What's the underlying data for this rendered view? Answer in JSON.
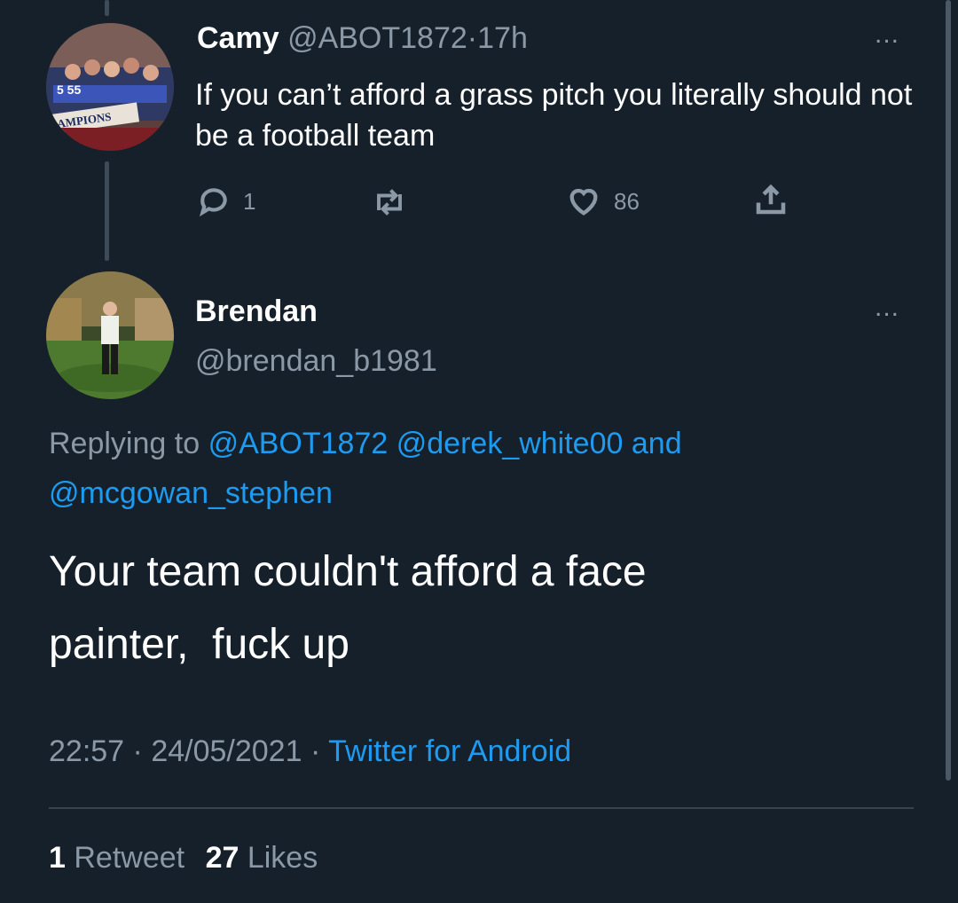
{
  "first_tweet": {
    "display_name": "Camy",
    "handle": "@ABOT1872",
    "separator": "·",
    "time": "17h",
    "more": "...",
    "text": "If you can’t afford a grass pitch you literally should not be a football team",
    "replies": "1",
    "retweets": "",
    "likes": "86",
    "avatar_banner": "AMPIONS",
    "avatar_numbers": "5  55"
  },
  "main_tweet": {
    "display_name": "Brendan",
    "handle": "@brendan_b1981",
    "more": "...",
    "replying_prefix": "Replying to",
    "reply_mentions": [
      "@ABOT1872",
      "@derek_white00",
      "and",
      "@mcgowan_stephen"
    ],
    "text": "Your team couldn't afford a face painter,  fuck up",
    "time": "22:57",
    "date": "24/05/2021",
    "separator": "·",
    "source": "Twitter for Android"
  },
  "stats": {
    "retweet_count": "1",
    "retweet_label": "Retweet",
    "like_count": "27",
    "like_label": "Likes"
  },
  "colors": {
    "background": "#15202b",
    "text": "#ffffff",
    "secondary": "#8b98a5",
    "accent": "#1d9bf0"
  },
  "icons": [
    "reply-icon",
    "retweet-icon",
    "like-icon",
    "share-icon",
    "more-icon"
  ]
}
